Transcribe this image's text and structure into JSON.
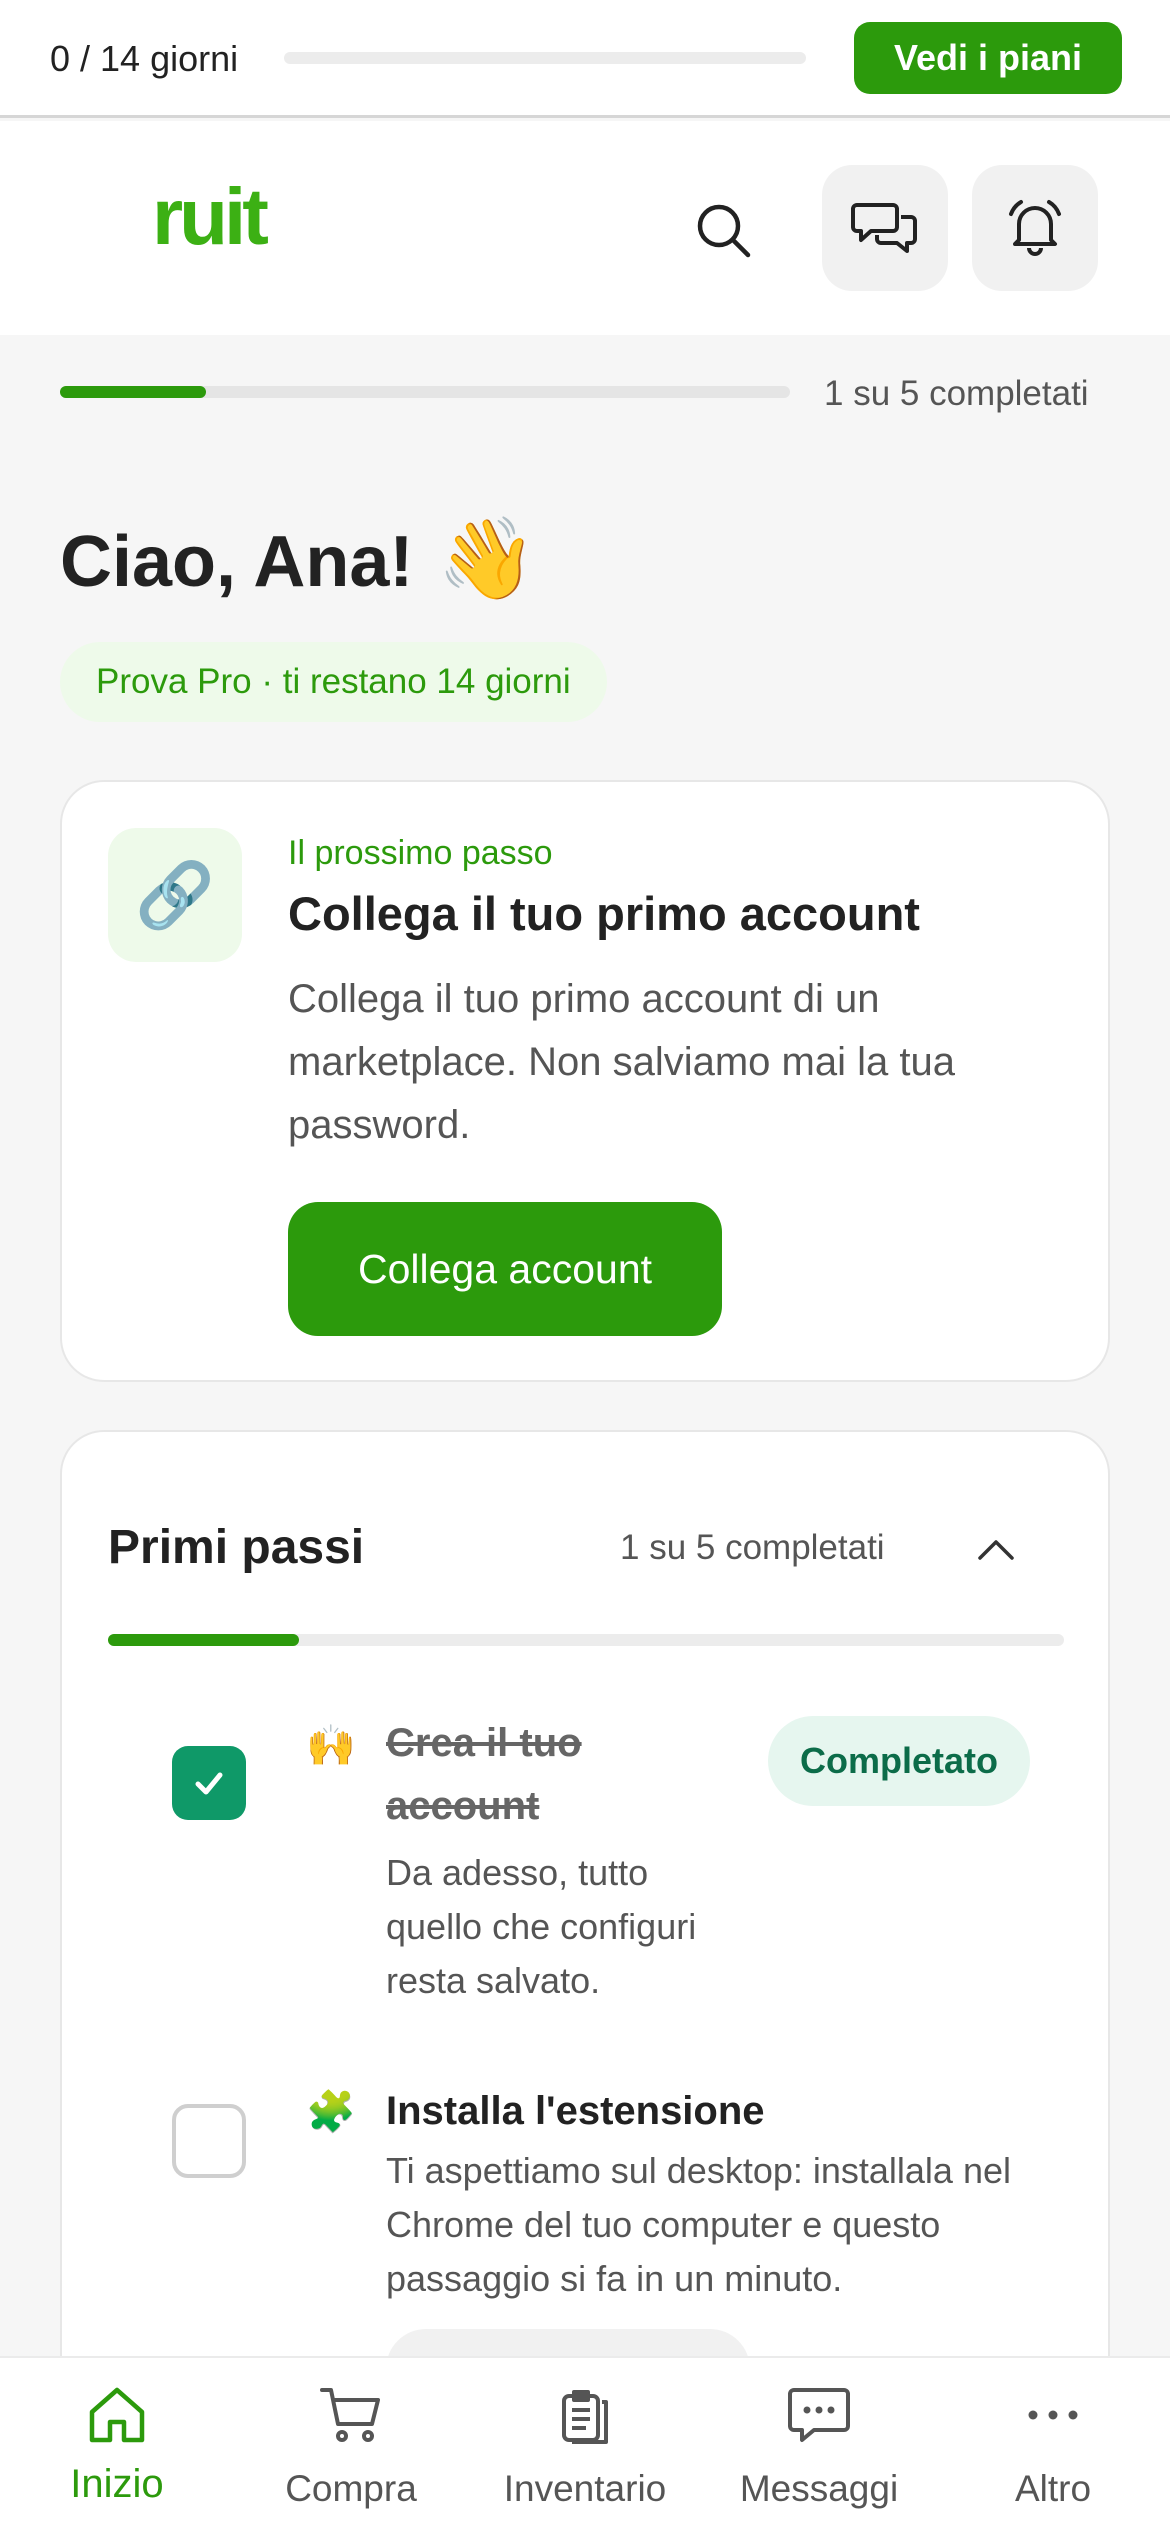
{
  "trial_bar": {
    "days_label": "0 / 14 giorni",
    "progress": 0,
    "plans_button": "Vedi i piani"
  },
  "header": {
    "logo": "ruit",
    "icons": [
      "search-icon",
      "chat-icon",
      "bell-icon"
    ]
  },
  "onboarding": {
    "progress_label": "1 su 5 completati",
    "progress": 0.2
  },
  "greeting": {
    "text": "Ciao, Ana!",
    "emoji": "👋"
  },
  "trial_pill": "Prova Pro · ti restano 14 giorni",
  "next_step": {
    "icon": "🔗",
    "kicker": "Il prossimo passo",
    "title": "Collega il tuo primo account",
    "description": "Collega il tuo primo account di un marketplace. Non salviamo mai la tua password.",
    "button": "Collega account"
  },
  "first_steps": {
    "title": "Primi passi",
    "count_label": "1 su 5 completati",
    "progress": 0.2,
    "items": [
      {
        "emoji": "🙌",
        "title": "Crea il tuo account",
        "description": "Da adesso, tutto quello che configuri resta salvato.",
        "status": "Completato",
        "done": true
      },
      {
        "emoji": "🧩",
        "title": "Installa l'estensione",
        "description": "Ti aspettiamo sul desktop: installala nel Chrome del tuo computer e questo passaggio si fa in un minuto.",
        "done": false
      }
    ]
  },
  "bottom_nav": [
    {
      "label": "Inizio",
      "icon": "home-icon",
      "active": true
    },
    {
      "label": "Compra",
      "icon": "cart-icon",
      "active": false
    },
    {
      "label": "Inventario",
      "icon": "clipboard-icon",
      "active": false
    },
    {
      "label": "Messaggi",
      "icon": "message-icon",
      "active": false
    },
    {
      "label": "Altro",
      "icon": "more-icon",
      "active": false
    }
  ],
  "colors": {
    "brand": "#2c9a0c",
    "logo": "#3cb014",
    "success": "#0f9968"
  }
}
